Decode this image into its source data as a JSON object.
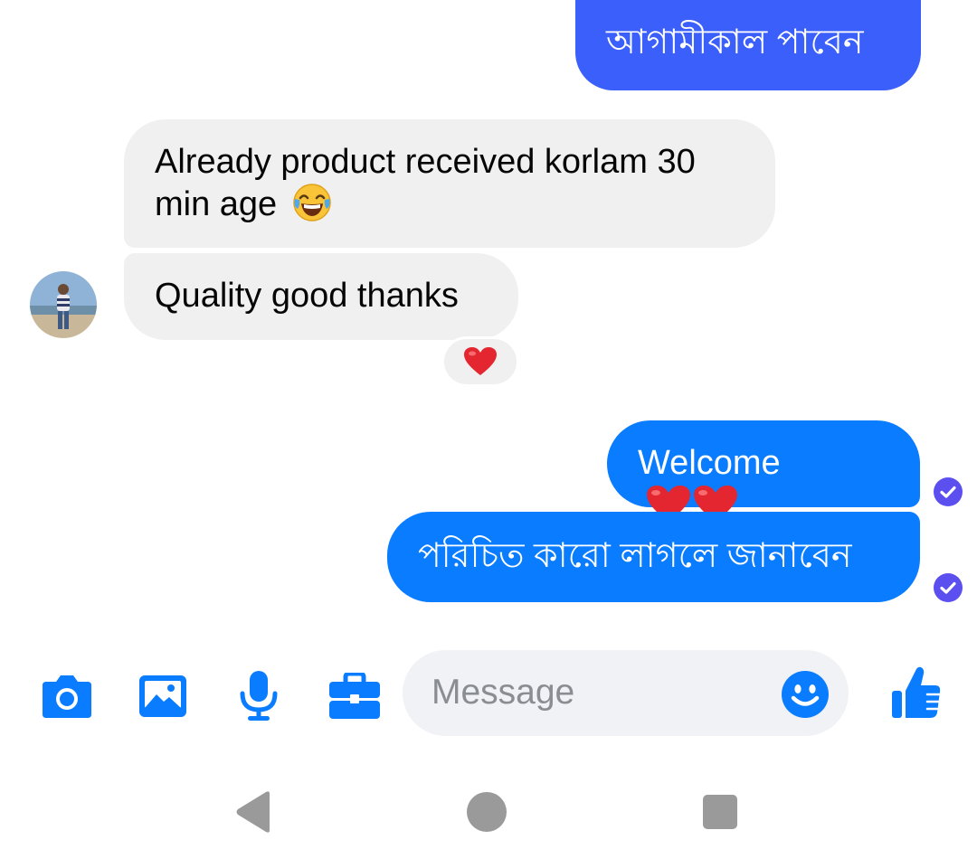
{
  "conversation": {
    "messages": [
      {
        "direction": "outgoing",
        "text": "আগামীকাল পাবেন"
      },
      {
        "direction": "incoming",
        "text": "Already product received korlam 30 min age",
        "emoji": "face-with-tears-of-joy-icon"
      },
      {
        "direction": "incoming",
        "text": "Quality good thanks"
      },
      {
        "direction": "outgoing",
        "text": "Welcome",
        "emoji": "two-red-hearts-icon"
      },
      {
        "direction": "outgoing",
        "text": "পরিচিত কারো লাগলে জানাবেন"
      }
    ],
    "reaction": "red-heart-icon",
    "colors": {
      "outgoing_top": "#3b5ffb",
      "outgoing": "#0a7cff",
      "incoming": "#f0f0f0",
      "seen_check": "#5b4ff0",
      "accent": "#0a7cff"
    }
  },
  "composer": {
    "placeholder": "Message",
    "value": "",
    "icons": [
      "camera-icon",
      "gallery-icon",
      "microphone-icon",
      "toolbox-icon",
      "emoji-icon",
      "thumbs-up-icon"
    ]
  },
  "navbar": {
    "icons": [
      "back-triangle-icon",
      "home-circle-icon",
      "recents-square-icon"
    ]
  }
}
